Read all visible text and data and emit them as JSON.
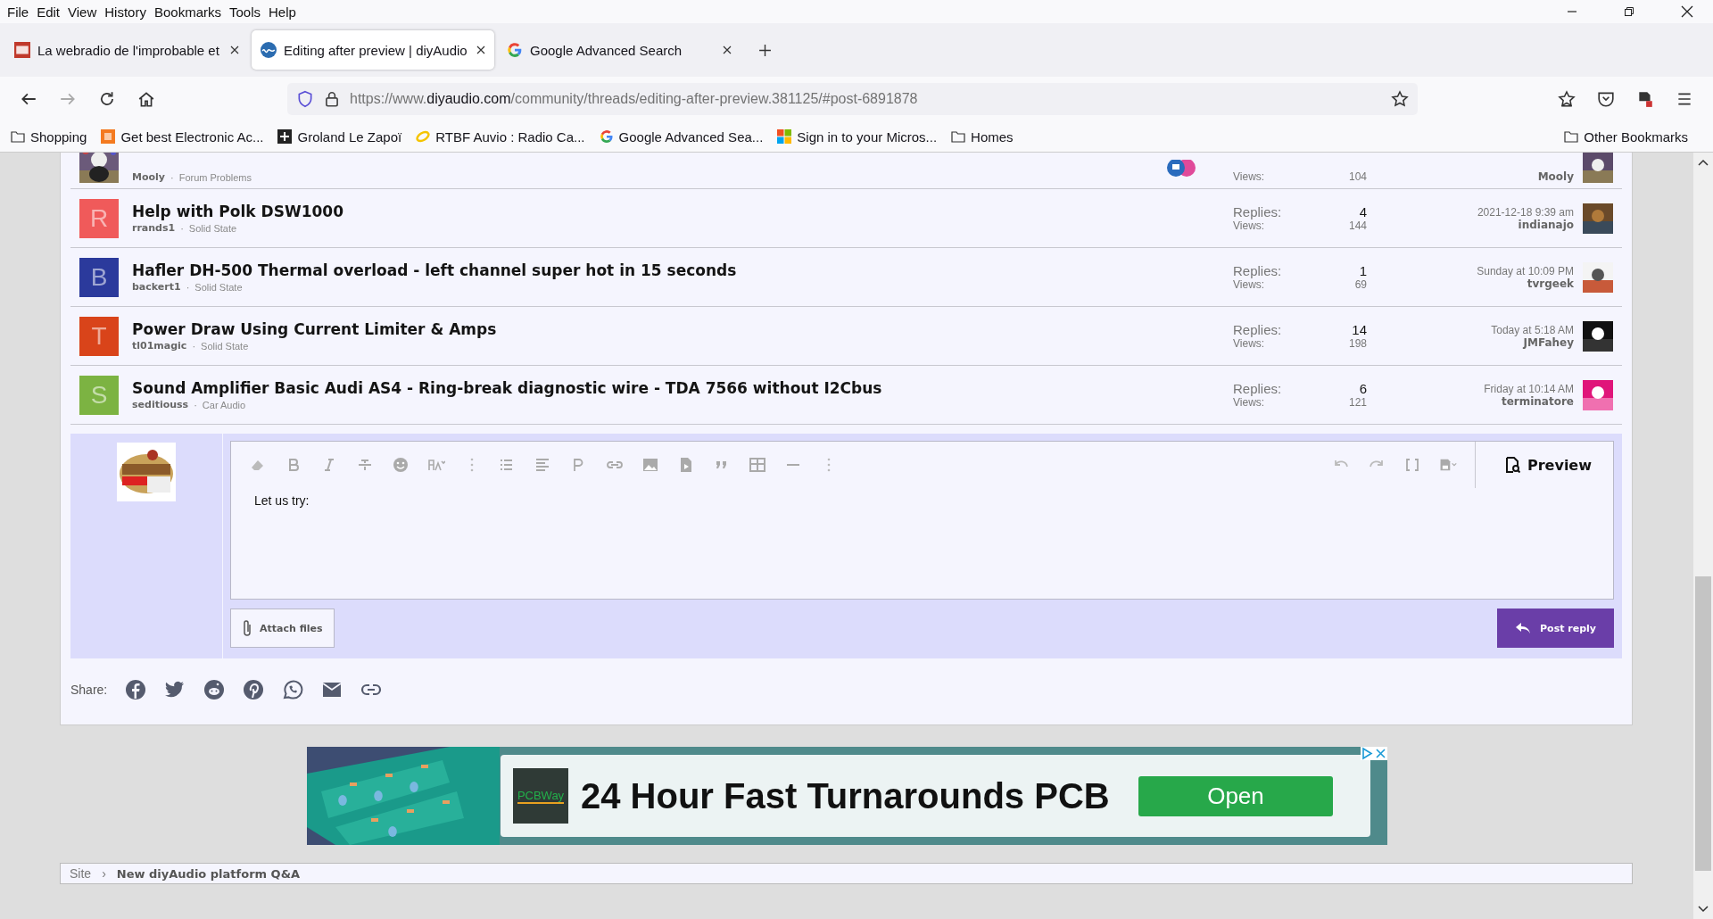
{
  "menu_bar": [
    "File",
    "Edit",
    "View",
    "History",
    "Bookmarks",
    "Tools",
    "Help"
  ],
  "tabs": [
    {
      "label": "La webradio de l'improbable et",
      "selected": false,
      "kind": "bm"
    },
    {
      "label": "Editing after preview | diyAudio",
      "selected": true,
      "kind": "wave"
    },
    {
      "label": "Google Advanced Search",
      "selected": false,
      "kind": "g"
    }
  ],
  "address_bar": {
    "prefix": "https://www.",
    "domain": "diyaudio.com",
    "path": "/community/threads/editing-after-preview.381125/#post-6891878"
  },
  "bookmarks": [
    {
      "label": "Shopping",
      "kind": "folder"
    },
    {
      "label": "Get best Electronic Ac...",
      "kind": "bg"
    },
    {
      "label": "Groland Le Zapoï",
      "kind": "plus"
    },
    {
      "label": "RTBF Auvio : Radio Ca...",
      "kind": "ring"
    },
    {
      "label": "Google Advanced Sea...",
      "kind": "g"
    },
    {
      "label": "Sign in to your Micros...",
      "kind": "ms"
    },
    {
      "label": "Homes",
      "kind": "folder"
    }
  ],
  "other_bookmarks": "Other Bookmarks",
  "threads": [
    {
      "author": "Mooly",
      "forum": "Forum Problems",
      "views_label": "Views:",
      "views": "104",
      "last_poster": "Mooly",
      "kind": "picture",
      "badges": true
    },
    {
      "title": "Help with Polk DSW1000",
      "author": "rrands1",
      "forum": "Solid State",
      "replies_label": "Replies:",
      "replies": "4",
      "views_label": "Views:",
      "views": "144",
      "date": "2021-12-18 9:39 am",
      "last_poster": "indianajo",
      "kind": "letter",
      "letter": "R",
      "color": "#f05a5a"
    },
    {
      "title": "Hafler DH-500 Thermal overload - left channel super hot in 15 seconds",
      "author": "backert1",
      "forum": "Solid State",
      "replies_label": "Replies:",
      "replies": "1",
      "views_label": "Views:",
      "views": "69",
      "date": "Sunday at 10:09 PM",
      "last_poster": "tvrgeek",
      "kind": "letter",
      "letter": "B",
      "color": "#2b3a9c"
    },
    {
      "title": "Power Draw Using Current Limiter & Amps",
      "author": "tl01magic",
      "forum": "Solid State",
      "replies_label": "Replies:",
      "replies": "14",
      "views_label": "Views:",
      "views": "198",
      "date": "Today at 5:18 AM",
      "last_poster": "JMFahey",
      "kind": "letter",
      "letter": "T",
      "color": "#d9441a"
    },
    {
      "title": "Sound Amplifier Basic Audi AS4 - Ring-break diagnostic wire - TDA 7566 without I2Cbus",
      "author": "seditiouss",
      "forum": "Car Audio",
      "replies_label": "Replies:",
      "replies": "6",
      "views_label": "Views:",
      "views": "121",
      "date": "Friday at 10:14 AM",
      "last_poster": "terminatore",
      "kind": "letter",
      "letter": "S",
      "color": "#7cb342"
    }
  ],
  "meta_separator": "·",
  "editor": {
    "text": "Let us try:",
    "preview": "Preview",
    "attach": "Attach files",
    "post": "Post reply"
  },
  "share": {
    "label": "Share:"
  },
  "ad": {
    "brand": "PCBWay",
    "headline": "24 Hour Fast Turnarounds PCB",
    "button": "Open"
  },
  "breadcrumb": [
    {
      "label": "Site",
      "current": false
    },
    {
      "label": "New diyAudio platform Q&A",
      "current": true
    }
  ],
  "breadcrumb_separator": "›"
}
